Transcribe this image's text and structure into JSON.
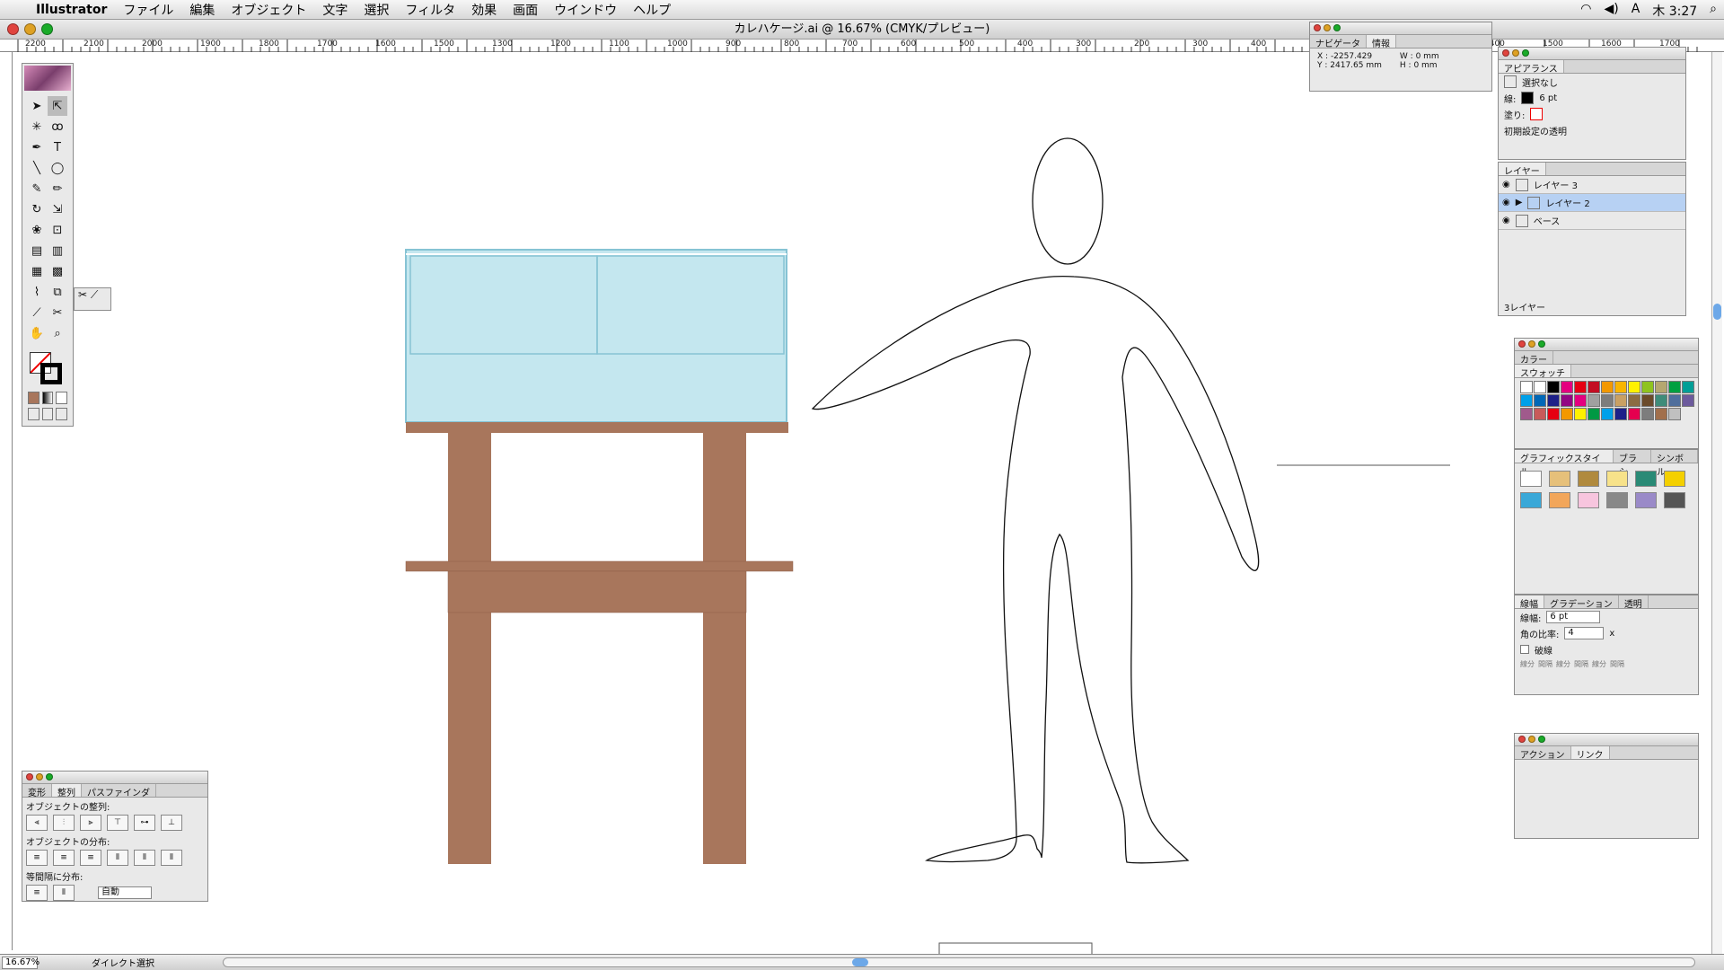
{
  "menubar": {
    "app": "Illustrator",
    "items": [
      "ファイル",
      "編集",
      "オブジェクト",
      "文字",
      "選択",
      "フィルタ",
      "効果",
      "画面",
      "ウインドウ",
      "ヘルプ"
    ],
    "clock": "木 3:27"
  },
  "document": {
    "title": "カレハケージ.ai @ 16.67% (CMYK/プレビュー)"
  },
  "ruler": {
    "top_ticks": [
      "2200",
      "2100",
      "2000",
      "1900",
      "1800",
      "1700",
      "1600",
      "1500",
      "1300",
      "1200",
      "1100",
      "1000",
      "900",
      "800",
      "700",
      "600",
      "500",
      "400",
      "300",
      "200",
      "300",
      "400",
      "500",
      "600",
      "700",
      "1400",
      "1500",
      "1600",
      "1700"
    ]
  },
  "info_panel": {
    "tabs": [
      "ナビゲータ",
      "情報"
    ],
    "x_label": "X :",
    "x_value": "-2257.429",
    "y_label": "Y :",
    "y_value": "2417.65 mm",
    "w_label": "W :",
    "w_value": "0 mm",
    "h_label": "H :",
    "h_value": "0 mm"
  },
  "appearance_panel": {
    "tab": "アピアランス",
    "selection": "選択なし",
    "stroke_label": "線:",
    "stroke_value": "6 pt",
    "fill_label": "塗り:",
    "opacity_label": "初期設定の透明"
  },
  "layers_panel": {
    "tab": "レイヤー",
    "layers": [
      "レイヤー 3",
      "レイヤー 2",
      "ベース"
    ],
    "footer": "3レイヤー"
  },
  "color_panel": {
    "tab": "カラー"
  },
  "swatch_panel": {
    "tab": "スウォッチ",
    "colors": [
      "#ffffff",
      "#ffffff",
      "#000000",
      "#e4007f",
      "#e60012",
      "#c30d23",
      "#f39800",
      "#f8b500",
      "#fff100",
      "#8fc31f",
      "#b5a770",
      "#00a040",
      "#009e96",
      "#00a0e9",
      "#0068b7",
      "#1d2088",
      "#920783",
      "#e4007f",
      "#a0a0a0",
      "#7d7d7d",
      "#c9a063",
      "#8b6c42",
      "#6b4a2a",
      "#3e8c7a",
      "#4f6e9c",
      "#6c5a9c",
      "#a05a8c",
      "#c85a5a",
      "#e60012",
      "#f39800",
      "#fff100",
      "#009944",
      "#00a0e9",
      "#1d2088",
      "#e5004f",
      "#7d7d7d",
      "#a16f4c",
      "#c0c0c0"
    ]
  },
  "graphic_style_panel": {
    "tabs": [
      "グラフィックスタイル",
      "ブラシ",
      "シンボル"
    ]
  },
  "stroke_panel": {
    "tabs": [
      "線幅",
      "グラデーション",
      "透明"
    ],
    "weight_label": "線幅:",
    "weight_value": "6 pt",
    "miter_label": "角の比率:",
    "miter_value": "4",
    "miter_unit": "x",
    "dashed_label": "破線",
    "dash_labels": [
      "線分",
      "間隔",
      "線分",
      "間隔",
      "線分",
      "間隔"
    ]
  },
  "actions_panel": {
    "tabs": [
      "アクション",
      "リンク"
    ]
  },
  "align_panel": {
    "tabs": [
      "変形",
      "整列",
      "パスファインダ"
    ],
    "section1": "オブジェクトの整列:",
    "section2": "オブジェクトの分布:",
    "section3": "等間隔に分布:",
    "spacing_value": "自動"
  },
  "statusbar": {
    "zoom": "16.67%",
    "tool": "ダイレクト選択"
  },
  "colors": {
    "aquarium": "#c4e7ef",
    "aquarium_stroke": "#86c3d4",
    "stand": "#a8765c",
    "selection_blue": "#b7d1f3"
  }
}
